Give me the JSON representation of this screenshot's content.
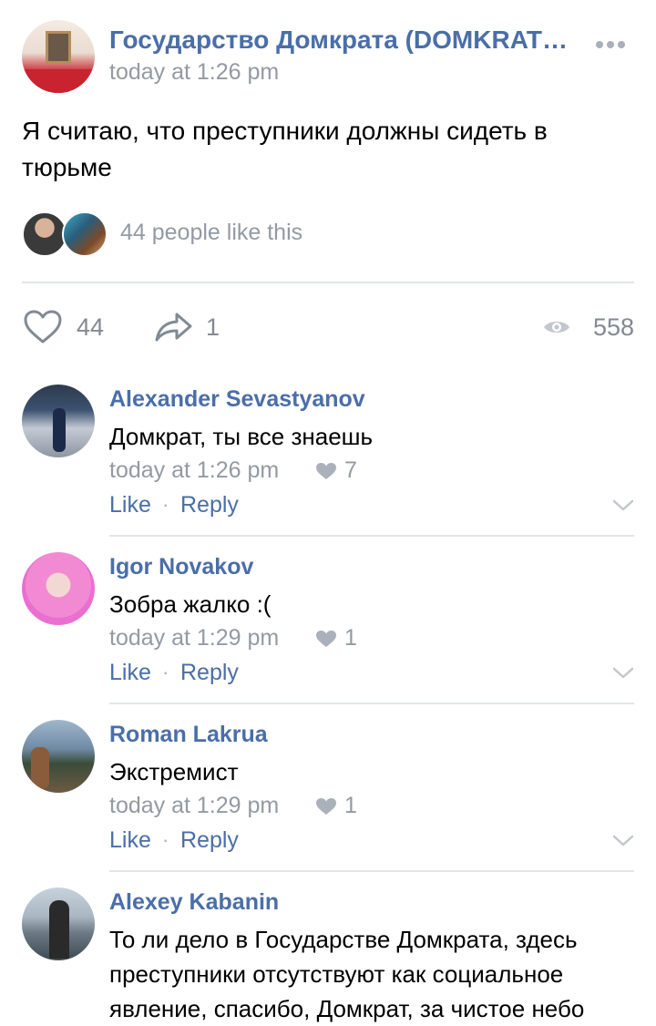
{
  "post": {
    "group_name": "Государство Домкрата (DOMKRAT…",
    "time": "today at 1:26 pm",
    "text": "Я считаю, что преступники должны сидеть в тюрьме",
    "likers_text": "44 people like this",
    "like_count": "44",
    "share_count": "1",
    "view_count": "558",
    "icons": {
      "more": "more-dots-icon",
      "like": "heart-outline-icon",
      "share": "share-arrow-icon",
      "views": "eye-icon"
    }
  },
  "comments": [
    {
      "author": "Alexander Sevastyanov",
      "text": "Домкрат, ты все знаешь",
      "time": "today at 1:26 pm",
      "likes": "7",
      "like_label": "Like",
      "separator": "·",
      "reply_label": "Reply"
    },
    {
      "author": "Igor Novakov",
      "text": "Зобра жалко :(",
      "time": "today at 1:29 pm",
      "likes": "1",
      "like_label": "Like",
      "separator": "·",
      "reply_label": "Reply"
    },
    {
      "author": "Roman Lakrua",
      "text": "Экстремист",
      "time": "today at 1:29 pm",
      "likes": "1",
      "like_label": "Like",
      "separator": "·",
      "reply_label": "Reply"
    },
    {
      "author": "Alexey Kabanin",
      "text": "То ли дело в Государстве Домкрата, здесь преступники отсутствуют как социальное явление, спасибо, Домкрат, за чистое небо"
    }
  ],
  "colors": {
    "link_blue": "#4a6ea8",
    "meta_gray": "#939aa3",
    "divider": "#e4e6e9",
    "icon_gray": "#a9b0b9"
  }
}
